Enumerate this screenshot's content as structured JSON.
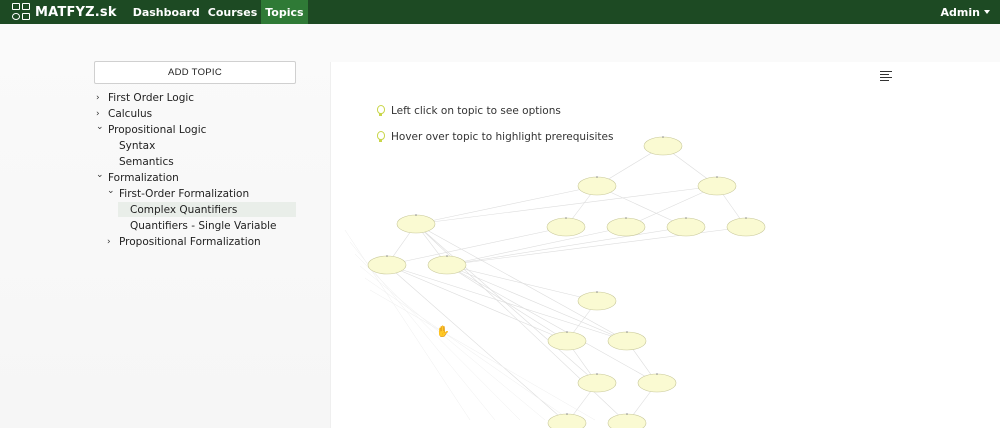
{
  "navbar": {
    "brand": "MATFYZ.sk",
    "links": [
      {
        "label": "Dashboard",
        "active": false
      },
      {
        "label": "Courses",
        "active": false
      },
      {
        "label": "Topics",
        "active": true
      }
    ],
    "user": "Admin",
    "bg_color": "#1d4a23",
    "active_color": "#2f7a36"
  },
  "sidebar": {
    "add_button": "ADD TOPIC",
    "tree": [
      {
        "label": "First Order Logic",
        "level": 0,
        "chevron": "right",
        "selected": false
      },
      {
        "label": "Calculus",
        "level": 0,
        "chevron": "right",
        "selected": false
      },
      {
        "label": "Propositional Logic",
        "level": 0,
        "chevron": "down",
        "selected": false
      },
      {
        "label": "Syntax",
        "level": 1,
        "chevron": "none",
        "selected": false
      },
      {
        "label": "Semantics",
        "level": 1,
        "chevron": "none",
        "selected": false
      },
      {
        "label": "Formalization",
        "level": 0,
        "chevron": "down",
        "selected": false
      },
      {
        "label": "First-Order Formalization",
        "level": 1,
        "chevron": "down",
        "selected": false
      },
      {
        "label": "Complex Quantifiers",
        "level": 2,
        "chevron": "none",
        "selected": true
      },
      {
        "label": "Quantifiers - Single Variable",
        "level": 2,
        "chevron": "none",
        "selected": false
      },
      {
        "label": "Propositional Formalization",
        "level": 1,
        "chevron": "right",
        "selected": false
      }
    ]
  },
  "hints": [
    {
      "text": "Left click on topic to see options",
      "icon": "lightbulb-icon"
    },
    {
      "text": "Hover over topic to highlight prerequisites",
      "icon": "lightbulb-icon"
    }
  ],
  "graph": {
    "node_color": "#fafad2",
    "node_stroke": "#c8c89a",
    "edge_color": "#dddddd"
  }
}
